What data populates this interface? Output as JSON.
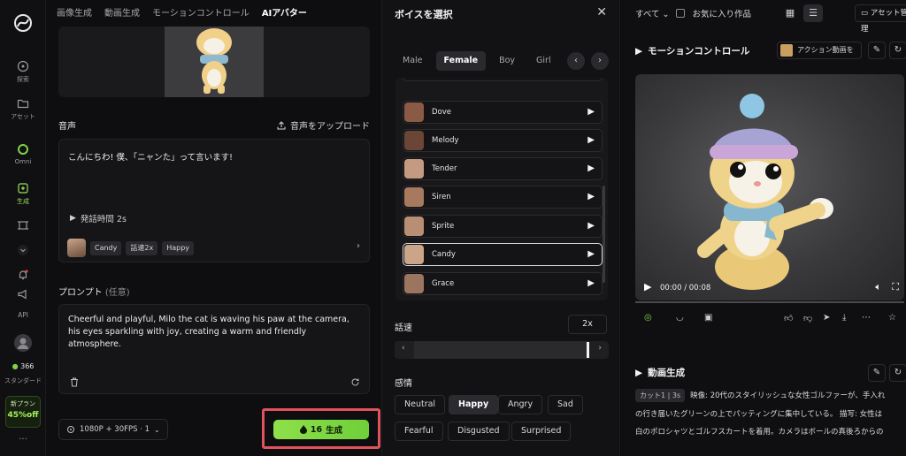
{
  "rail": {
    "items": [
      {
        "label": "探索"
      },
      {
        "label": "アセット"
      },
      {
        "label": "Omni"
      },
      {
        "label": "生成"
      },
      {
        "label": "API"
      }
    ],
    "credits": "366",
    "plan": "スタンダード",
    "promo_top": "新プラン",
    "promo_bottom": "45%off"
  },
  "tabs": [
    "画像生成",
    "動画生成",
    "モーションコントロール",
    "AIアバター"
  ],
  "voice": {
    "section_label": "音声",
    "upload_label": "音声をアップロード",
    "text": "こんにちわ! 僕、「ニャンた」って言います!",
    "duration": "発話時間 2s",
    "chips": [
      "Candy",
      "話速2x",
      "Happy"
    ]
  },
  "prompt": {
    "label": "プロンプト",
    "optional": "(任意)",
    "text": "Cheerful and playful, Milo the cat is waving his paw at the camera, his eyes sparkling with joy, creating a warm and friendly atmosphere."
  },
  "footer": {
    "resolution": "1080P + 30FPS · 1",
    "generate_cost": "16",
    "generate_label": "生成"
  },
  "voice_picker": {
    "title": "ボイスを選択",
    "gender_tabs": [
      "Male",
      "Female",
      "Boy",
      "Girl"
    ],
    "selected_tab": "Female",
    "voices": [
      {
        "name": "Dove",
        "color": "#8a5a44"
      },
      {
        "name": "Melody",
        "color": "#6b4636"
      },
      {
        "name": "Tender",
        "color": "#c49a80"
      },
      {
        "name": "Siren",
        "color": "#a77a60"
      },
      {
        "name": "Sprite",
        "color": "#b88e74"
      },
      {
        "name": "Candy",
        "color": "#caa58a"
      },
      {
        "name": "Grace",
        "color": "#9c7560"
      }
    ],
    "selected_voice": "Candy",
    "speed_label": "話速",
    "speed_value": "2x",
    "speed_level_percent": 100,
    "emotion_label": "感情",
    "emotions": [
      "Neutral",
      "Happy",
      "Angry",
      "Sad",
      "Fearful",
      "Disgusted",
      "Surprised"
    ],
    "selected_emotion": "Happy"
  },
  "right": {
    "filter_all": "すべて",
    "favorites": "お気に入り作品",
    "asset_manage": "アセット管理",
    "motion_title": "モーションコントロール",
    "action_video": "アクション動画を",
    "time": "00:00 / 00:08",
    "video_gen_title": "動画生成",
    "cut": "カット1 | 3s",
    "desc_line1": "映像: 20代のスタイリッシュな女性ゴルファーが、手入れ",
    "desc_line2": "の行き届いたグリーンの上でパッティングに集中している。 描写: 女性は",
    "desc_line3": "白のポロシャツとゴルフスカートを着用。カメラはボールの真後ろからの"
  }
}
